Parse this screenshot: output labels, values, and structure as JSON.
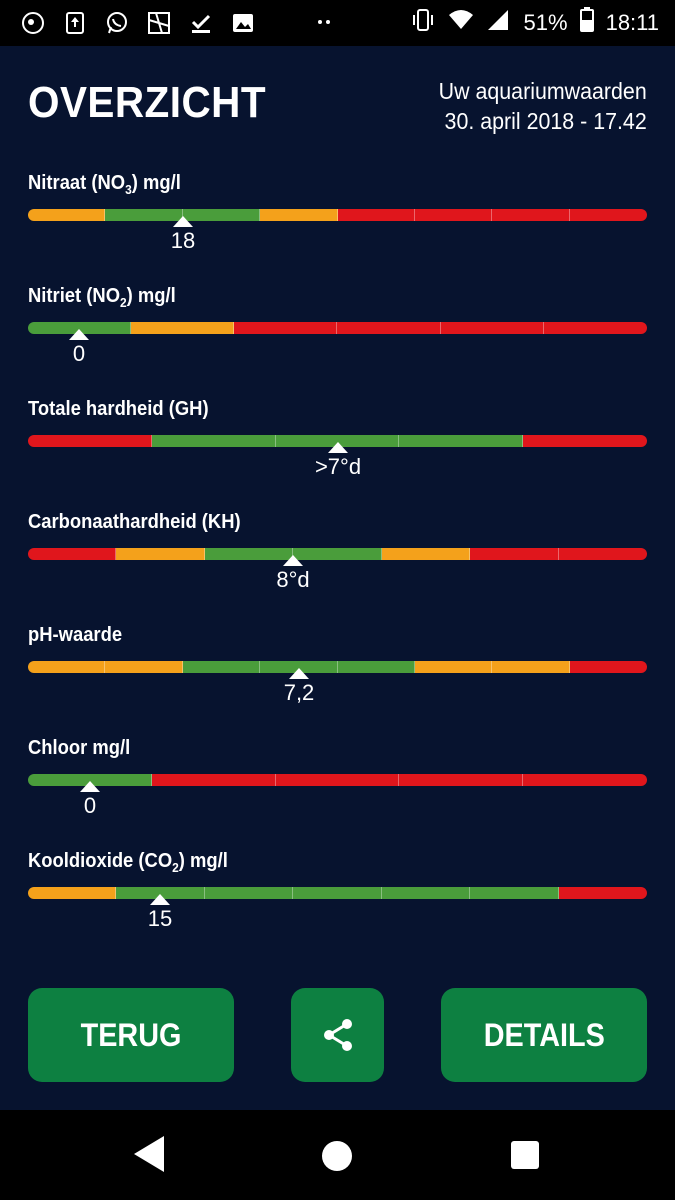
{
  "status_bar": {
    "battery": "51%",
    "time": "18:11",
    "icons_left": [
      "app-icon",
      "upload-icon",
      "whatsapp-icon",
      "image-icon",
      "download-done-icon",
      "gallery-icon"
    ],
    "icons_right": [
      "vibrate-icon",
      "wifi-icon",
      "signal-icon",
      "battery-icon"
    ]
  },
  "header": {
    "title": "OVERZICHT",
    "subtitle_line1": "Uw aquariumwaarden",
    "subtitle_line2": "30. april 2018 - 17.42"
  },
  "colors": {
    "orange": "#f4a11b",
    "green": "#4a9d3b",
    "red": "#e0161c",
    "background": "#07132f",
    "button": "#0d8041"
  },
  "params": [
    {
      "label_pre": "Nitraat (NO",
      "label_sub": "3",
      "label_post": ") mg/l",
      "value": "18",
      "marker_fraction": 0.25,
      "segments": [
        "orange",
        "green",
        "green",
        "orange",
        "red",
        "red",
        "red",
        "red"
      ]
    },
    {
      "label_pre": "Nitriet (NO",
      "label_sub": "2",
      "label_post": ") mg/l",
      "value": "0",
      "marker_fraction": 0.083,
      "segments": [
        "green",
        "orange",
        "red",
        "red",
        "red",
        "red"
      ]
    },
    {
      "label_pre": "Totale hardheid (GH)",
      "label_sub": "",
      "label_post": "",
      "value": ">7°d",
      "marker_fraction": 0.5,
      "segments": [
        "red",
        "green",
        "green",
        "green",
        "red"
      ]
    },
    {
      "label_pre": "Carbonaathardheid (KH)",
      "label_sub": "",
      "label_post": "",
      "value": "8°d",
      "marker_fraction": 0.428,
      "segments": [
        "red",
        "orange",
        "green",
        "green",
        "orange",
        "red",
        "red"
      ]
    },
    {
      "label_pre": "pH-waarde",
      "label_sub": "",
      "label_post": "",
      "value": "7,2",
      "marker_fraction": 0.438,
      "segments": [
        "orange",
        "orange",
        "green",
        "green",
        "green",
        "orange",
        "orange",
        "red"
      ]
    },
    {
      "label_pre": "Chloor mg/l",
      "label_sub": "",
      "label_post": "",
      "value": "0",
      "marker_fraction": 0.1,
      "segments": [
        "green",
        "red",
        "red",
        "red",
        "red"
      ]
    },
    {
      "label_pre": "Kooldioxide (CO",
      "label_sub": "2",
      "label_post": ") mg/l",
      "value": "15",
      "marker_fraction": 0.214,
      "segments": [
        "orange",
        "green",
        "green",
        "green",
        "green",
        "green",
        "red"
      ]
    }
  ],
  "buttons": {
    "back": "TERUG",
    "share": "share-icon",
    "details": "DETAILS"
  },
  "navbar": {
    "back": "back-icon",
    "home": "home-icon",
    "recent": "recent-apps-icon"
  }
}
